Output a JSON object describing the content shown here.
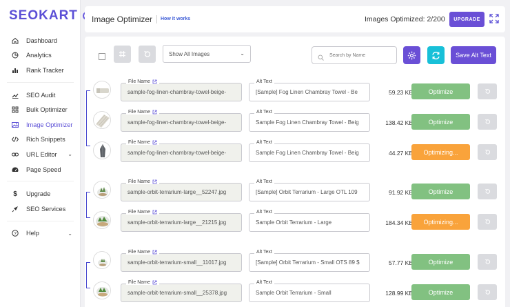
{
  "brand": {
    "logo_text": "SEOKART"
  },
  "sidebar": {
    "items": [
      {
        "label": "Dashboard",
        "icon": "home-icon"
      },
      {
        "label": "Analytics",
        "icon": "pie-chart-icon"
      },
      {
        "label": "Rank Tracker",
        "icon": "bar-chart-icon"
      },
      {
        "label": "SEO Audit",
        "icon": "trend-line-icon"
      },
      {
        "label": "Bulk Optimizer",
        "icon": "grid-icon"
      },
      {
        "label": "Image Optimizer",
        "icon": "image-icon",
        "active": true
      },
      {
        "label": "Rich Snippets",
        "icon": "code-icon"
      },
      {
        "label": "URL Editor",
        "icon": "link-icon"
      },
      {
        "label": "Page Speed",
        "icon": "speedometer-icon"
      },
      {
        "label": "Upgrade",
        "icon": "dollar-icon"
      },
      {
        "label": "SEO Services",
        "icon": "rocket-icon"
      },
      {
        "label": "Help",
        "icon": "question-icon"
      }
    ]
  },
  "header": {
    "title": "Image Optimizer",
    "how_link": "How it works",
    "images_optimized": "Images Optimized: 2/200",
    "upgrade_label": "UPGRADE"
  },
  "toolbar": {
    "filter_selected": "Show All Images",
    "search_placeholder": "Search by Name",
    "save_alt_label": "Save Alt Text"
  },
  "labels": {
    "file_name": "File Name",
    "alt_text": "Alt Text"
  },
  "rows": [
    {
      "file": "sample-fog-linen-chambray-towel-beige-",
      "alt": "[Sample] Fog Linen Chambray Towel - Be",
      "size": "59.23 KB",
      "action": "Optimize",
      "state": "green"
    },
    {
      "file": "sample-fog-linen-chambray-towel-beige-",
      "alt": "Sample Fog Linen Chambray Towel - Beig",
      "size": "138.42 KB",
      "action": "Optimize",
      "state": "green"
    },
    {
      "file": "sample-fog-linen-chambray-towel-beige-",
      "alt": "Sample Fog Linen Chambray Towel - Beig",
      "size": "44.27 KB",
      "action": "Optimizing...",
      "state": "orange"
    },
    {
      "file": "sample-orbit-terrarium-large__52247.jpg",
      "alt": "[Sample] Orbit Terrarium - Large OTL 109",
      "size": "91.92 KB",
      "action": "Optimize",
      "state": "green"
    },
    {
      "file": "sample-orbit-terrarium-large__21215.jpg",
      "alt": "Sample Orbit Terrarium - Large",
      "size": "184.34 KB",
      "action": "Optimizing...",
      "state": "orange"
    },
    {
      "file": "sample-orbit-terrarium-small__11017.jpg",
      "alt": "[Sample] Orbit Terrarium - Small OTS 89 $",
      "size": "57.77 KB",
      "action": "Optimize",
      "state": "green"
    },
    {
      "file": "sample-orbit-terrarium-small__25378.jpg",
      "alt": "Sample Orbit Terrarium - Small",
      "size": "128.99 KB",
      "action": "Optimize",
      "state": "green"
    }
  ],
  "colors": {
    "accent": "#6a4fd6",
    "cyan": "#18c0d8",
    "green": "#82c181",
    "orange": "#f9a33b"
  }
}
